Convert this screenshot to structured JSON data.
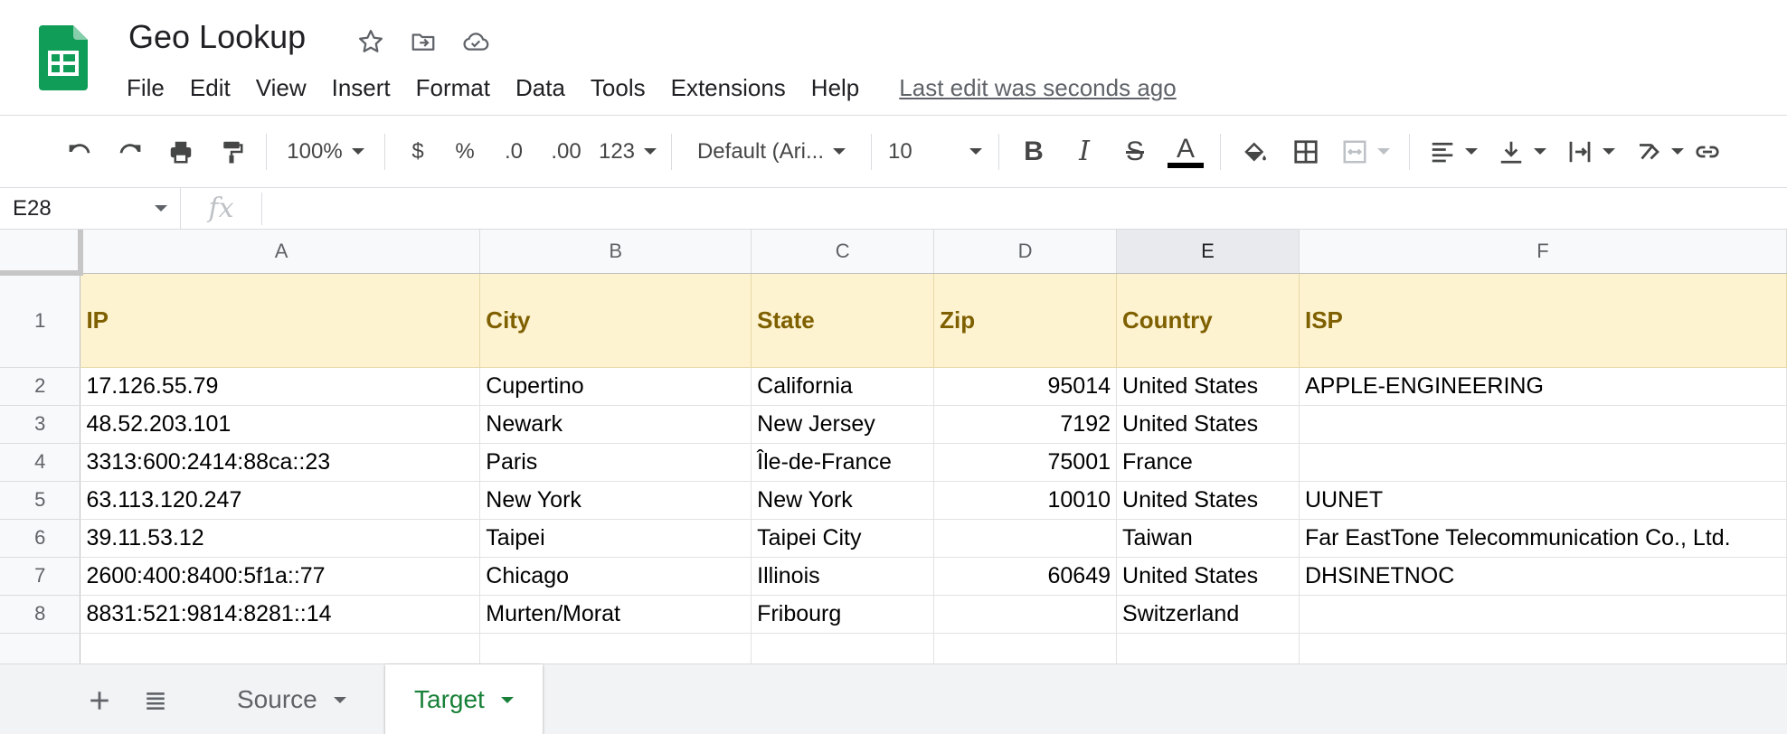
{
  "app": {
    "title": "Geo Lookup",
    "icons": [
      "star-icon",
      "move-to-folder-icon",
      "cloud-saved-icon"
    ],
    "brand_color": "#0f9d58"
  },
  "menu": {
    "items": [
      "File",
      "Edit",
      "View",
      "Insert",
      "Format",
      "Data",
      "Tools",
      "Extensions",
      "Help"
    ],
    "last_edit": "Last edit was seconds ago"
  },
  "toolbar": {
    "zoom": "100%",
    "currency": "$",
    "percent": "%",
    "decrease_decimal": ".0",
    "increase_decimal": ".00",
    "number_format": "123",
    "font": "Default (Ari...",
    "font_size": "10",
    "bold": "B",
    "italic": "I",
    "strikethrough": "S",
    "text_color": "A"
  },
  "formula_bar": {
    "name_box": "E28",
    "fx": "fx",
    "value": ""
  },
  "grid": {
    "columns": [
      "A",
      "B",
      "C",
      "D",
      "E",
      "F"
    ],
    "selected_column": "E",
    "header_row": {
      "row_number": "1",
      "cells": [
        "IP",
        "City",
        "State",
        "Zip",
        "Country",
        "ISP"
      ]
    },
    "rows": [
      {
        "n": "2",
        "ip": "17.126.55.79",
        "city": "Cupertino",
        "state": "California",
        "zip": "95014",
        "country": "United States",
        "isp": "APPLE-ENGINEERING"
      },
      {
        "n": "3",
        "ip": "48.52.203.101",
        "city": "Newark",
        "state": "New Jersey",
        "zip": "7192",
        "country": "United States",
        "isp": ""
      },
      {
        "n": "4",
        "ip": "3313:600:2414:88ca::23",
        "city": "Paris",
        "state": "Île-de-France",
        "zip": "75001",
        "country": "France",
        "isp": ""
      },
      {
        "n": "5",
        "ip": "63.113.120.247",
        "city": "New York",
        "state": "New York",
        "zip": "10010",
        "country": "United States",
        "isp": "UUNET"
      },
      {
        "n": "6",
        "ip": "39.11.53.12",
        "city": "Taipei",
        "state": "Taipei City",
        "zip": "",
        "country": "Taiwan",
        "isp": "Far EastTone Telecommunication Co., Ltd."
      },
      {
        "n": "7",
        "ip": "2600:400:8400:5f1a::77",
        "city": "Chicago",
        "state": "Illinois",
        "zip": "60649",
        "country": "United States",
        "isp": "DHSINETNOC"
      },
      {
        "n": "8",
        "ip": "8831:521:9814:8281::14",
        "city": "Murten/Morat",
        "state": "Fribourg",
        "zip": "",
        "country": "Switzerland",
        "isp": ""
      }
    ]
  },
  "sheets": {
    "tabs": [
      "Source",
      "Target"
    ],
    "active": "Target",
    "active_color": "#188038"
  }
}
